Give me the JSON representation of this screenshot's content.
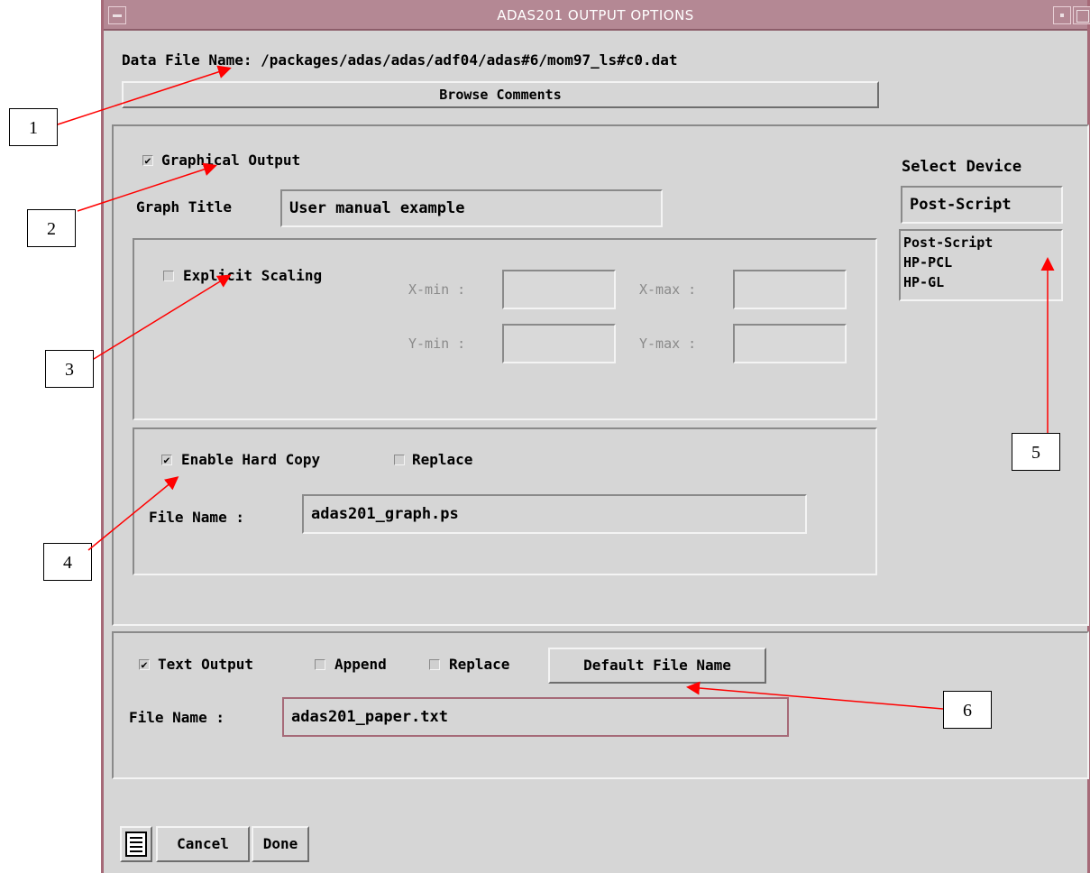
{
  "window": {
    "title": "ADAS201 OUTPUT OPTIONS"
  },
  "data_file": {
    "label": "Data File Name: /packages/adas/adas/adf04/adas#6/mom97_ls#c0.dat"
  },
  "browse_button": "Browse Comments",
  "graphical": {
    "checkbox_label": "Graphical Output",
    "checked": true,
    "graph_title_label": "Graph Title",
    "graph_title_value": "User manual example",
    "scaling": {
      "label": "Explicit Scaling",
      "checked": false,
      "xmin_label": "X-min :",
      "xmax_label": "X-max :",
      "ymin_label": "Y-min :",
      "ymax_label": "Y-max :"
    },
    "hardcopy": {
      "label": "Enable Hard Copy",
      "checked": true,
      "replace_label": "Replace",
      "replace_checked": false,
      "file_label": "File Name :",
      "file_value": "adas201_graph.ps"
    }
  },
  "device": {
    "title": "Select Device",
    "selected": "Post-Script",
    "options": [
      "Post-Script",
      "HP-PCL",
      "HP-GL"
    ]
  },
  "text_output": {
    "label": "Text Output",
    "checked": true,
    "append_label": "Append",
    "append_checked": false,
    "replace_label": "Replace",
    "replace_checked": false,
    "default_button": "Default File Name",
    "file_label": "File Name :",
    "file_value": "adas201_paper.txt"
  },
  "footer": {
    "menu_icon": "list-menu-icon",
    "cancel": "Cancel",
    "done": "Done"
  },
  "callouts": [
    "1",
    "2",
    "3",
    "4",
    "5",
    "6"
  ],
  "colors": {
    "arrow": "#ff0000",
    "titlebar": "#b48894",
    "window_bg": "#d6d6d6"
  }
}
